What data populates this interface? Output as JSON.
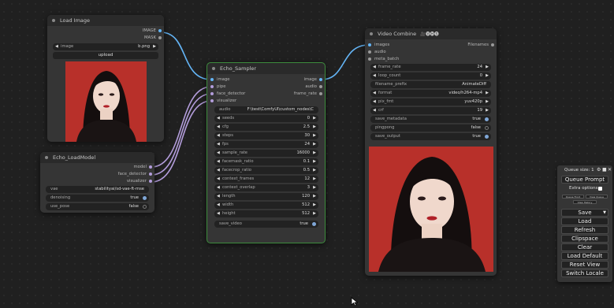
{
  "load_image": {
    "title": "Load Image",
    "outputs": [
      "IMAGE",
      "MASK"
    ],
    "image_label": "image",
    "image_value": "b.png",
    "upload_label": "upload"
  },
  "echo_loadmodel": {
    "title": "Echo_LoadModel",
    "outputs": [
      "model",
      "face_detector",
      "visualizer"
    ],
    "vae_label": "vae",
    "vae_value": "stabilityai/sd-vae-ft-mse",
    "denoising_label": "denoising",
    "denoising_value": "true",
    "use_pose_label": "use_pose",
    "use_pose_value": "false"
  },
  "echo_sampler": {
    "title": "Echo_Sampler",
    "inputs": [
      "image",
      "pipe",
      "face_detector",
      "visualizer"
    ],
    "outputs": [
      "image",
      "audio",
      "frame_rate"
    ],
    "audio_label": "audio",
    "audio_value": "F:\\test\\ComfyUI\\custom_nodes\\C",
    "widgets": [
      {
        "label": "seeds",
        "value": "0"
      },
      {
        "label": "cfg",
        "value": "2.5"
      },
      {
        "label": "steps",
        "value": "30"
      },
      {
        "label": "fps",
        "value": "24"
      },
      {
        "label": "sample_rate",
        "value": "16000"
      },
      {
        "label": "facemask_ratio",
        "value": "0.1"
      },
      {
        "label": "facecrop_ratio",
        "value": "0.5"
      },
      {
        "label": "context_frames",
        "value": "12"
      },
      {
        "label": "context_overlap",
        "value": "3"
      },
      {
        "label": "length",
        "value": "120"
      },
      {
        "label": "width",
        "value": "512"
      },
      {
        "label": "height",
        "value": "512"
      }
    ],
    "save_video_label": "save_video",
    "save_video_value": "true"
  },
  "video_combine": {
    "title": "Video Combine",
    "title_icons": "🎥🅥🅗🅢",
    "inputs": [
      "images",
      "audio",
      "meta_batch"
    ],
    "output": "Filenames",
    "frame_rate_label": "frame_rate",
    "frame_rate_value": "24",
    "loop_count_label": "loop_count",
    "loop_count_value": "0",
    "filename_prefix_label": "filename_prefix",
    "filename_prefix_value": "AnimateDiff",
    "format_label": "format",
    "format_value": "video/h264-mp4",
    "pix_fmt_label": "pix_fmt",
    "pix_fmt_value": "yuv420p",
    "crf_label": "crf",
    "crf_value": "19",
    "save_metadata_label": "save_metadata",
    "save_metadata_value": "true",
    "pingpong_label": "pingpong",
    "pingpong_value": "false",
    "save_output_label": "save_output",
    "save_output_value": "true"
  },
  "queue_panel": {
    "title": "Queue size: 1",
    "queue_prompt": "Queue Prompt",
    "extra_options": "Extra options",
    "small_buttons": [
      "Queue Front",
      "View Queue",
      "View History"
    ],
    "buttons": [
      "Save",
      "Load",
      "Refresh",
      "Clipspace",
      "Clear",
      "Load Default",
      "Reset View",
      "Switch Locale"
    ]
  },
  "colors": {
    "canvas": "#202020",
    "node_body": "#353535",
    "node_title": "#2a2a2a",
    "selected_border": "#3d8b3d",
    "link_blue": "#64b5f6",
    "link_lavender": "#b39ddb",
    "photo_background": "#b8302a"
  }
}
